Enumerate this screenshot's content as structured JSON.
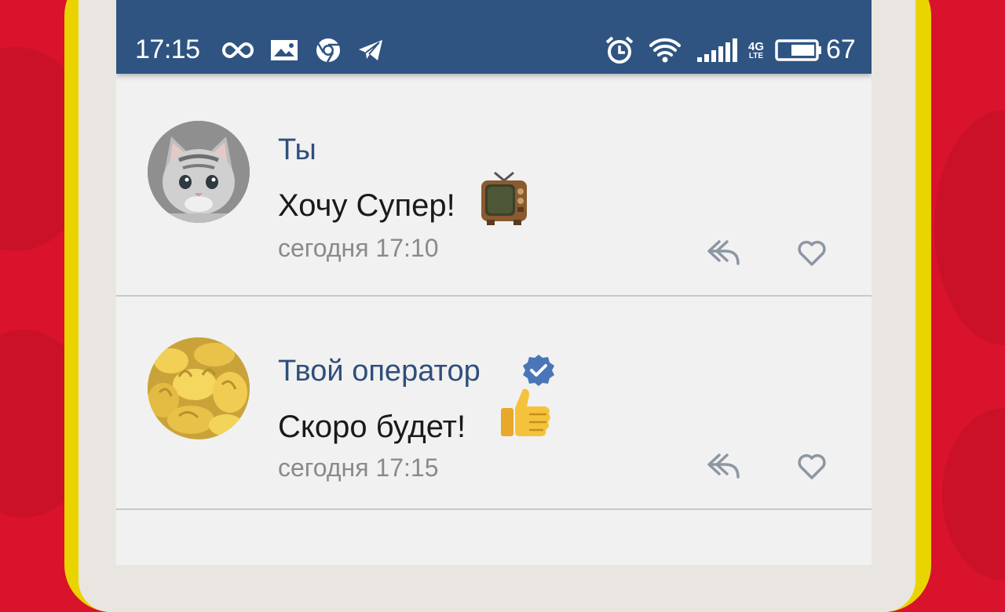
{
  "status_bar": {
    "time": "17:15",
    "battery_percent": "67",
    "network_label": "4G",
    "network_sub": "LTE",
    "icons": [
      "infinity-icon",
      "image-icon",
      "chrome-icon",
      "telegram-icon",
      "alarm-icon",
      "wifi-icon",
      "signal-icon",
      "battery-icon"
    ]
  },
  "messages": [
    {
      "author": "Ты",
      "text": "Хочу Супер!",
      "emoji": "television-emoji",
      "timestamp": "сегодня 17:10",
      "verified": false
    },
    {
      "author": "Твой оператор",
      "text": "Скоро будет!",
      "emoji": "thumbs-up-emoji",
      "timestamp": "сегодня 17:15",
      "verified": true
    }
  ],
  "colors": {
    "background": "#d8132b",
    "phone_frame": "#ead400",
    "status_bar": "#2f5481",
    "author_name": "#2f4f7a",
    "verified_badge": "#4a76b8",
    "timestamp": "#8a8a8a"
  }
}
